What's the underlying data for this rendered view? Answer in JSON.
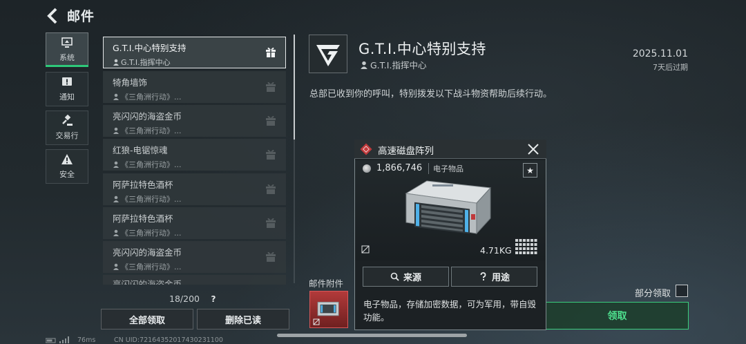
{
  "header": {
    "title": "邮件"
  },
  "categories": [
    {
      "label": "系统",
      "icon": "monitor-icon",
      "active": true
    },
    {
      "label": "通知",
      "icon": "alert-icon",
      "active": false
    },
    {
      "label": "交易行",
      "icon": "gavel-icon",
      "active": false
    },
    {
      "label": "安全",
      "icon": "warning-icon",
      "active": false
    }
  ],
  "mails": [
    {
      "title": "G.T.I.中心特别支持",
      "sender": "G.T.I.指挥中心",
      "selected": true
    },
    {
      "title": "犄角墙饰",
      "sender": "《三角洲行动》..."
    },
    {
      "title": "亮闪闪的海盗金币",
      "sender": "《三角洲行动》..."
    },
    {
      "title": "红狼-电锯惊魂",
      "sender": "《三角洲行动》..."
    },
    {
      "title": "阿萨拉特色酒杯",
      "sender": "《三角洲行动》..."
    },
    {
      "title": "阿萨拉特色酒杯",
      "sender": "《三角洲行动》..."
    },
    {
      "title": "亮闪闪的海盗金币",
      "sender": "《三角洲行动》..."
    }
  ],
  "mail_partial": "亮闪闪的海盗金币",
  "list_footer": {
    "count": "18/200",
    "help": "?",
    "claim_all": "全部领取",
    "delete_read": "删除已读"
  },
  "detail": {
    "title": "G.T.I.中心特别支持",
    "sender": "G.T.I.指挥中心",
    "date": "2025.11.01",
    "expire": "7天后过期",
    "body": "总部已收到你的呼叫，特别拨发以下战斗物资帮助后续行动。",
    "attachments_label": "邮件附件",
    "partial_claim_label": "部分领取",
    "claim_label": "领取"
  },
  "popup": {
    "name": "高速磁盘阵列",
    "price": "1,866,746",
    "category": "电子物品",
    "weight": "4.71KG",
    "source_label": "来源",
    "use_label": "用途",
    "description": "电子物品，存储加密数据，可为军用，带自毁功能。"
  },
  "footer": {
    "ping": "76ms",
    "uid": "CN UID:72164352017430231100"
  },
  "colors": {
    "accent_green": "#2ec97a",
    "claim_green": "#4ee08e",
    "rarity_red": "#c0393b"
  }
}
